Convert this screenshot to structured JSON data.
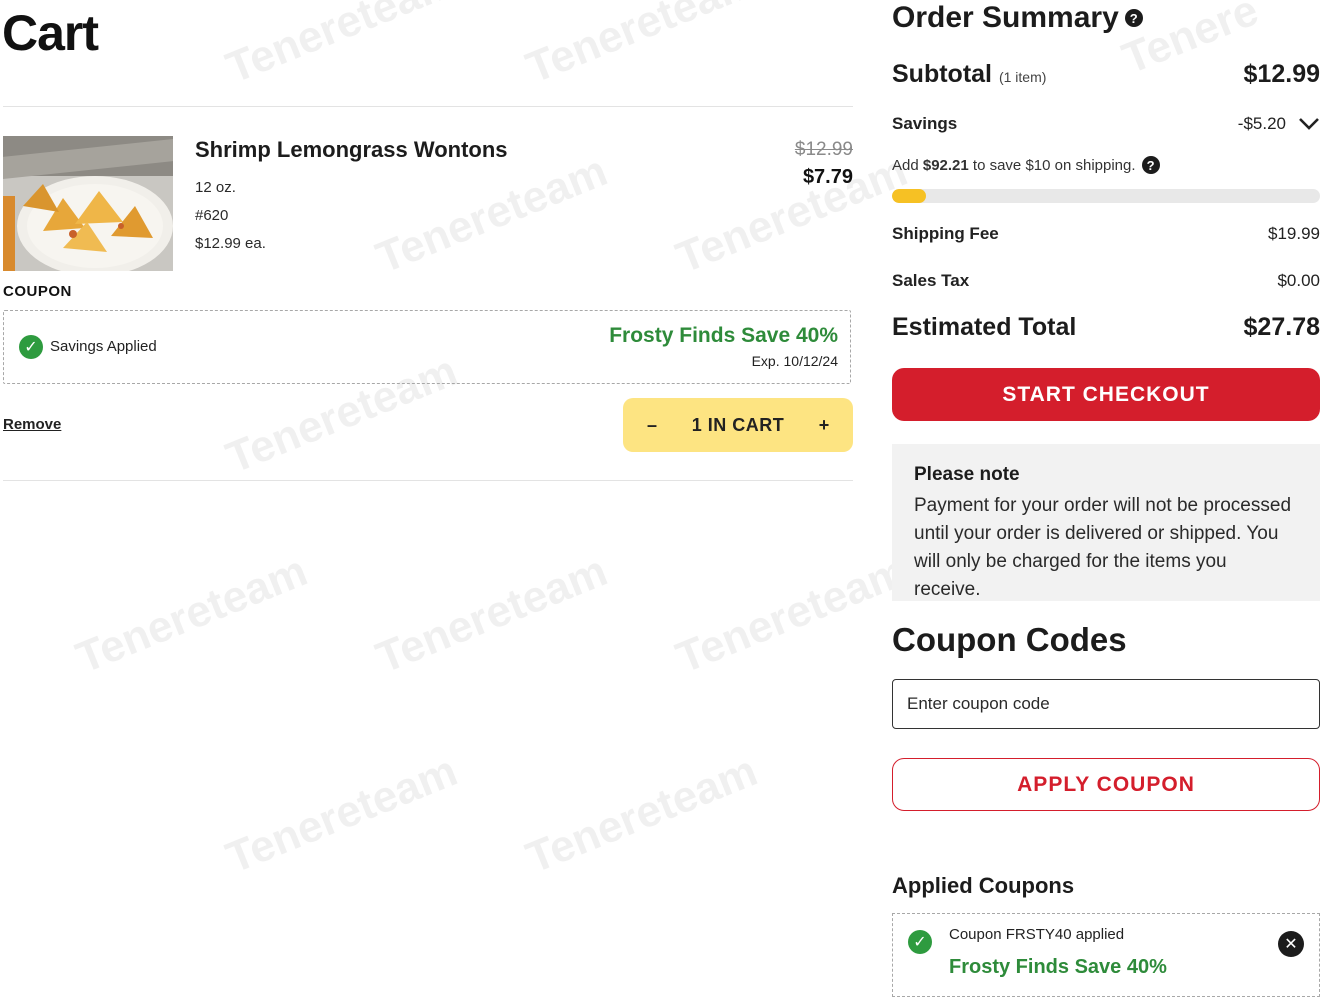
{
  "cart": {
    "title": "Cart",
    "item": {
      "name": "Shrimp Lemongrass Wontons",
      "size": "12 oz.",
      "sku": "#620",
      "unit_price": "$12.99 ea.",
      "original_price": "$12.99",
      "sale_price": "$7.79",
      "image_icon": "wonton-dish-image"
    },
    "coupon_label": "COUPON",
    "coupon": {
      "status": "Savings Applied",
      "promo_name": "Frosty Finds Save 40%",
      "expiry": "Exp. 10/12/24"
    },
    "remove_label": "Remove",
    "quantity": {
      "minus": "–",
      "label": "1 IN CART",
      "plus": "+"
    }
  },
  "summary": {
    "title": "Order Summary",
    "subtotal_label": "Subtotal",
    "subtotal_count": "(1 item)",
    "subtotal_value": "$12.99",
    "savings_label": "Savings",
    "savings_value": "-$5.20",
    "shipping_note_prefix": "Add ",
    "shipping_note_amount": "$92.21",
    "shipping_note_suffix": " to save $10 on shipping.",
    "shipping_progress": 0.08,
    "shipping_fee_label": "Shipping Fee",
    "shipping_fee_value": "$19.99",
    "sales_tax_label": "Sales Tax",
    "sales_tax_value": "$0.00",
    "total_label": "Estimated Total",
    "total_value": "$27.78",
    "checkout_label": "START CHECKOUT",
    "note_title": "Please note",
    "note_body": "Payment for your order will not be processed until your order is delivered or shipped. You will only be charged for the items you receive."
  },
  "coupons": {
    "title": "Coupon Codes",
    "input_placeholder": "Enter coupon code",
    "apply_label": "APPLY COUPON",
    "applied_title": "Applied Coupons",
    "applied_text": "Coupon FRSTY40 applied",
    "applied_promo": "Frosty Finds Save 40%"
  },
  "colors": {
    "accent_red": "#d41e2c",
    "promo_green": "#2e8b3a",
    "qty_yellow": "#fde482",
    "progress_yellow": "#f6c124"
  }
}
